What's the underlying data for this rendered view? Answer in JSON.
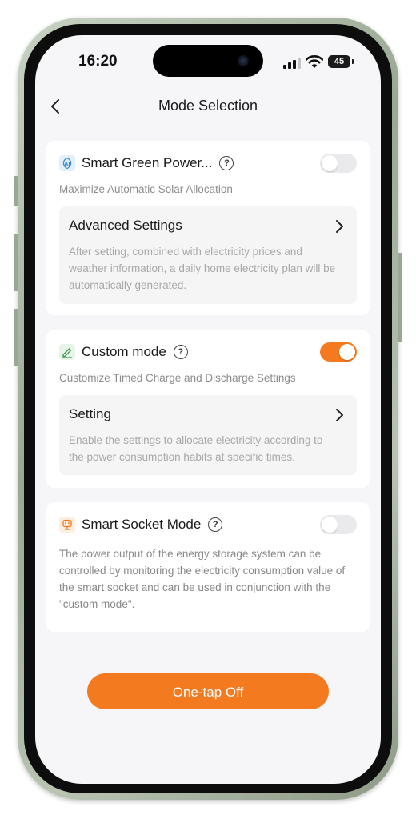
{
  "status_bar": {
    "time": "16:20",
    "battery": "45"
  },
  "header": {
    "title": "Mode Selection"
  },
  "smart_green": {
    "title": "Smart Green Power...",
    "subtitle": "Maximize Automatic Solar Allocation",
    "enabled": false,
    "settings_title": "Advanced Settings",
    "settings_desc": "After setting, combined with electricity prices and weather information, a daily home electricity plan will be automatically generated."
  },
  "custom_mode": {
    "title": "Custom mode",
    "subtitle": "Customize Timed Charge and Discharge Settings",
    "enabled": true,
    "settings_title": "Setting",
    "settings_desc": "Enable the settings to allocate electricity according to the power consumption habits at specific times."
  },
  "smart_socket": {
    "title": "Smart Socket Mode",
    "enabled": false,
    "desc": "The power output of the energy storage system can be controlled by monitoring the electricity consumption value of the smart socket and can be used in conjunction with the \"custom mode\"."
  },
  "footer": {
    "one_tap_off_label": "One-tap Off"
  },
  "help_glyph": "?",
  "colors": {
    "accent": "#f47a20",
    "toggle_off": "#eaeaec",
    "card_bg": "#ffffff",
    "page_bg": "#f6f5f7"
  },
  "icons": {
    "smart_green": "ai-leaf-icon",
    "custom_mode": "edit-pencil-icon",
    "smart_socket": "socket-plug-icon",
    "back": "chevron-left-icon",
    "help": "question-circle-icon",
    "chevron": "chevron-right-icon"
  }
}
